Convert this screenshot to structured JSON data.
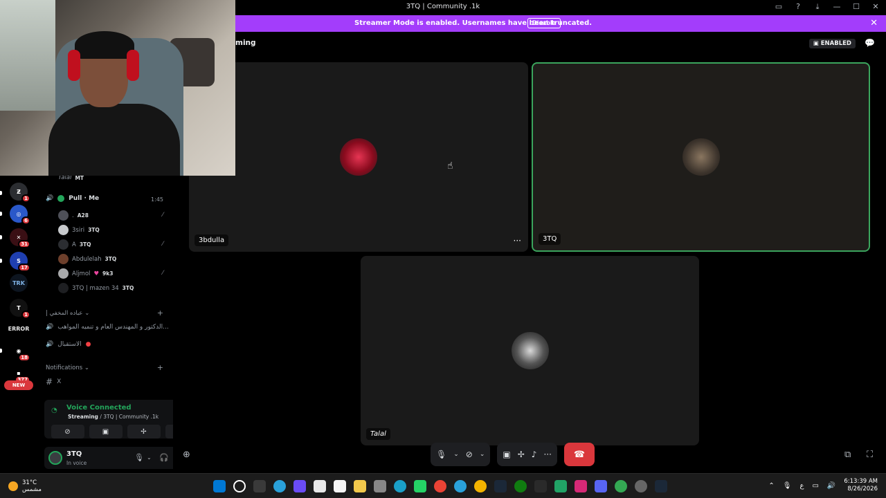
{
  "window": {
    "title": "3TQ | Community .1k"
  },
  "banner": {
    "message": "Streamer Mode is enabled. Usernames have been truncated.",
    "disable_label": "Disable"
  },
  "stage": {
    "header": "ming",
    "enabled_label": "ENABLED"
  },
  "tiles": [
    {
      "name": "3bdulla",
      "avatar_color": "#c2102f"
    },
    {
      "name": "3TQ",
      "avatar_color": "#6b5a4a"
    },
    {
      "name": "Talal",
      "avatar_color": "#444444"
    }
  ],
  "rail": {
    "badges": [
      "1",
      "6",
      "31",
      "17",
      "1",
      "18",
      "377"
    ],
    "labels": [
      "TRK",
      "ERROR"
    ],
    "new_label": "NEW"
  },
  "sidebar": {
    "top_user": {
      "name": "Talal",
      "tag": "MT"
    },
    "voice_channel": {
      "name": "Pull · Me",
      "time": "1:45"
    },
    "voice_users": [
      {
        "name": ".",
        "tag": "A28"
      },
      {
        "name": "3siri",
        "tag": "3TQ"
      },
      {
        "name": "A",
        "tag": "3TQ"
      },
      {
        "name": "Abdulelah",
        "tag": "3TQ"
      },
      {
        "name": "Aljmol",
        "tag": "9k3"
      },
      {
        "name": "3TQ | mazen 34",
        "tag": "3TQ"
      }
    ],
    "section1": "| عباده المخفي",
    "channel1": "الدكتور و المهندس العام و تنميه المواهب...",
    "channel2": "الاستقبال",
    "section2": "Notifications",
    "channel3": "X"
  },
  "voice_panel": {
    "title": "Voice Connected",
    "status": "Streaming",
    "server": "/ 3TQ | Community .1k"
  },
  "user": {
    "name": "3TQ",
    "status": "In voice"
  },
  "taskbar": {
    "temp": "31°C",
    "weather_text": "مشمس",
    "time": "6:13:39 AM",
    "date": "8/26/2026",
    "lang": "ع"
  }
}
